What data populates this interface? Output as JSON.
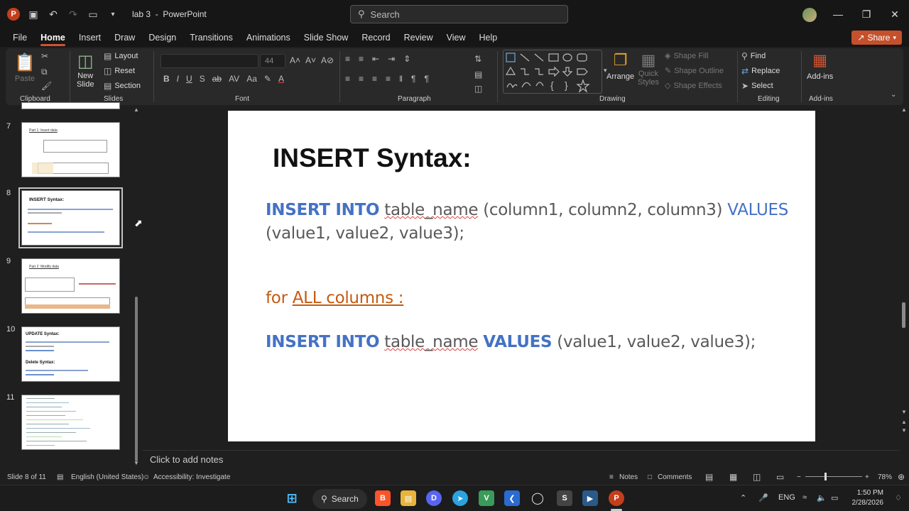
{
  "titlebar": {
    "doc_title": "lab 3",
    "app_name": "PowerPoint",
    "title_sep": "-",
    "search_placeholder": "Search"
  },
  "menu": [
    "File",
    "Home",
    "Insert",
    "Draw",
    "Design",
    "Transitions",
    "Animations",
    "Slide Show",
    "Record",
    "Review",
    "View",
    "Help"
  ],
  "active_menu": "Home",
  "share_label": "Share",
  "ribbon": {
    "clipboard": {
      "paste": "Paste",
      "label": "Clipboard"
    },
    "slides": {
      "new_slide": "New",
      "new_slide2": "Slide",
      "layout": "Layout",
      "reset": "Reset",
      "section": "Section",
      "label": "Slides"
    },
    "font": {
      "size": "44",
      "label": "Font"
    },
    "paragraph": {
      "label": "Paragraph"
    },
    "drawing": {
      "arrange": "Arrange",
      "quick_styles": "Quick",
      "quick_styles2": "Styles",
      "shape_fill": "Shape Fill",
      "shape_outline": "Shape Outline",
      "shape_effects": "Shape Effects",
      "label": "Drawing"
    },
    "editing": {
      "find": "Find",
      "replace": "Replace",
      "select": "Select",
      "label": "Editing"
    },
    "addins": {
      "button": "Add-ins",
      "label": "Add-ins"
    }
  },
  "thumbnails": [
    {
      "num": "7",
      "title": "Part 1: Insert data"
    },
    {
      "num": "8",
      "title": "INSERT Syntax:"
    },
    {
      "num": "9",
      "title": "Part 2: Modify data"
    },
    {
      "num": "10",
      "title": "UPDATE Syntax:",
      "title2": "Delete Syntax:"
    },
    {
      "num": "11",
      "title": ""
    }
  ],
  "slide": {
    "title": "INSERT Syntax:",
    "line1_kw": "INSERT INTO",
    "line1_table": "table_name",
    "line1_cols": "(column1, column2, column3)",
    "line1_values": "VALUES",
    "line2": "(value1, value2, value3);",
    "line3_for": "for",
    "line3_all": "ALL columns :",
    "line4_kw": "INSERT INTO",
    "line4_table": "table_name",
    "line4_values": "VALUES",
    "line4_vals": "(value1, value2, value3);"
  },
  "notes_placeholder": "Click to add notes",
  "status": {
    "slide_count": "Slide 8 of 11",
    "language": "English (United States)",
    "accessibility": "Accessibility: Investigate",
    "notes": "Notes",
    "comments": "Comments",
    "zoom": "78%"
  },
  "taskbar": {
    "search": "Search",
    "lang": "ENG",
    "time": "1:50 PM",
    "date": "2/28/2026"
  }
}
